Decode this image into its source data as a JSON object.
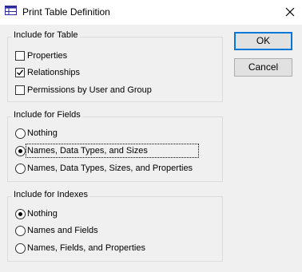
{
  "window": {
    "title": "Print Table Definition",
    "icon": "table-icon"
  },
  "buttons": {
    "ok": "OK",
    "cancel": "Cancel"
  },
  "table_group": {
    "title": "Include for Table",
    "items": [
      {
        "label": "Properties",
        "checked": false
      },
      {
        "label": "Relationships",
        "checked": true
      },
      {
        "label": "Permissions by User and Group",
        "checked": false
      }
    ]
  },
  "fields_group": {
    "title": "Include for Fields",
    "options": [
      {
        "label": "Nothing",
        "selected": false
      },
      {
        "label": "Names, Data Types, and Sizes",
        "selected": true
      },
      {
        "label": "Names, Data Types, Sizes, and Properties",
        "selected": false
      }
    ]
  },
  "indexes_group": {
    "title": "Include for Indexes",
    "options": [
      {
        "label": "Nothing",
        "selected": true
      },
      {
        "label": "Names and Fields",
        "selected": false
      },
      {
        "label": "Names, Fields, and Properties",
        "selected": false
      }
    ]
  }
}
